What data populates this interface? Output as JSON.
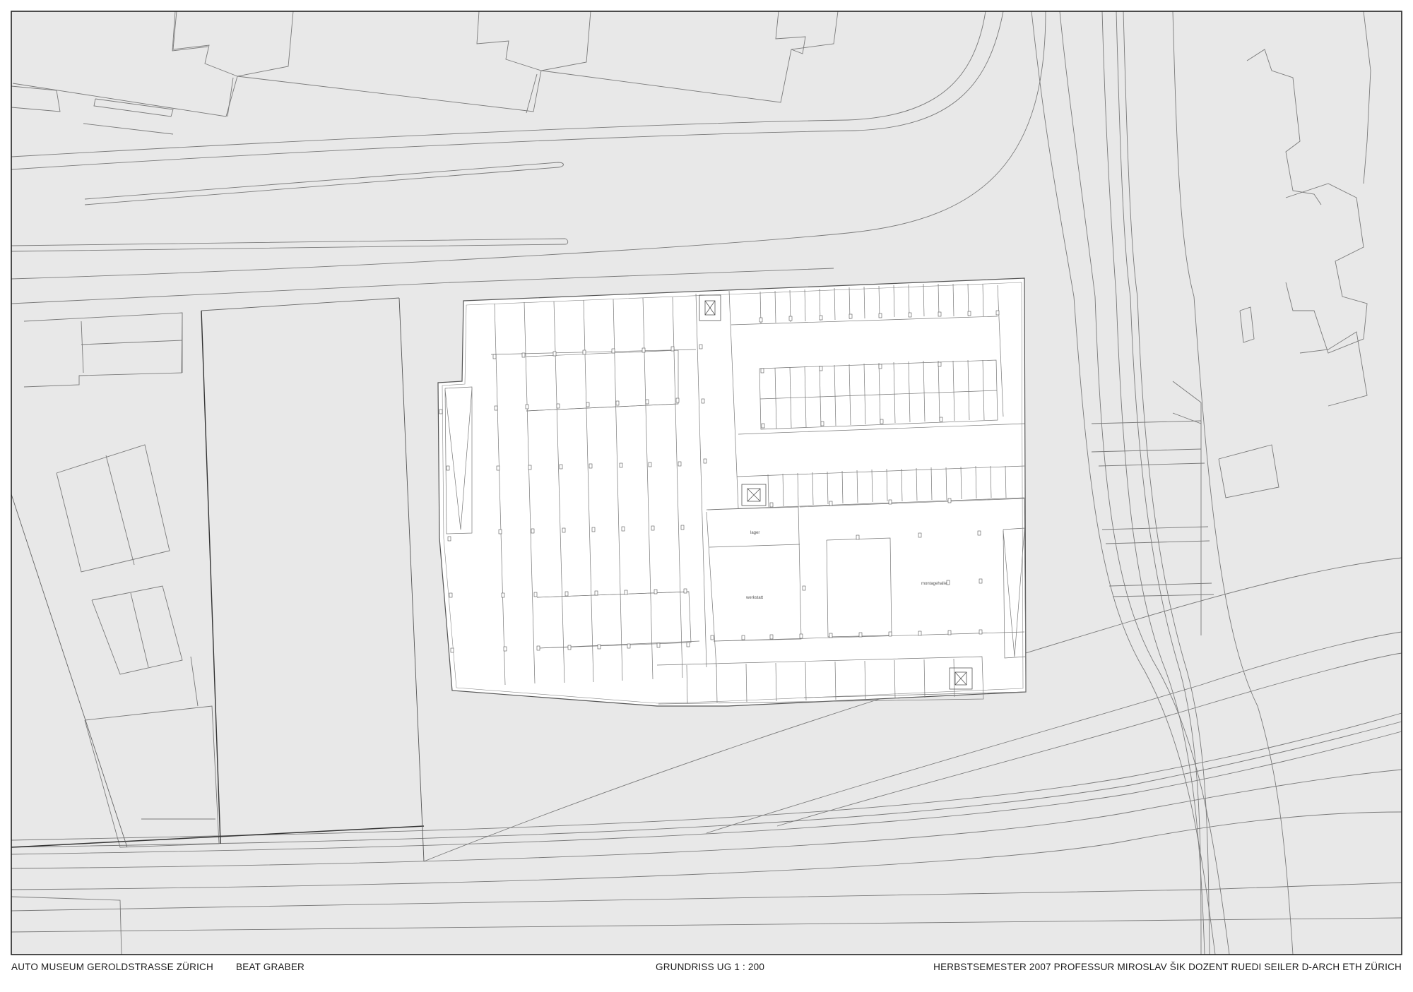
{
  "drawing": {
    "project": "AUTO MUSEUM  GEROLDSTRASSE  ZÜRICH",
    "author": "BEAT GRABER",
    "sheet_title": "GRUNDRISS UG 1 : 200",
    "credits": "HERBSTSEMESTER   2007   PROFESSUR MIROSLAV ŠIK   DOZENT RUEDI SEILER   D-ARCH   ETH ZÜRICH"
  },
  "plan": {
    "room_labels": [
      "lager",
      "werkstatt",
      "montagehalle"
    ]
  },
  "colors": {
    "background": "#e8e8e8",
    "building_fill": "#ffffff",
    "line": "#444444",
    "frame": "#222222"
  }
}
